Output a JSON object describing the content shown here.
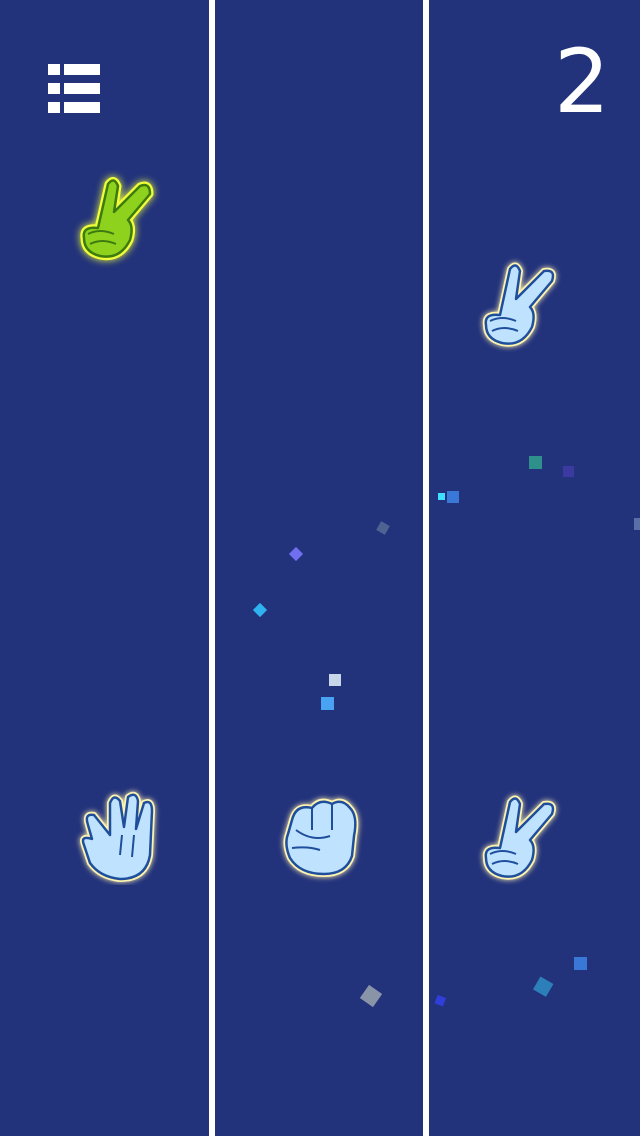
{
  "score": "2",
  "colors": {
    "background": "#22327b",
    "divider": "#ffffff",
    "hand_light": "#bfe3ff",
    "hand_outline": "#1f4f9c",
    "hand_active": "#8fd21e",
    "glow_active": "#f0ff38",
    "glow_light": "#fff3b0"
  },
  "icons": {
    "menu": "list-menu-icon"
  },
  "top_row": [
    {
      "gesture": "scissors",
      "state": "active"
    },
    {
      "gesture": "none"
    },
    {
      "gesture": "scissors",
      "state": "idle"
    }
  ],
  "bottom_row": [
    {
      "gesture": "paper"
    },
    {
      "gesture": "rock"
    },
    {
      "gesture": "scissors"
    }
  ]
}
